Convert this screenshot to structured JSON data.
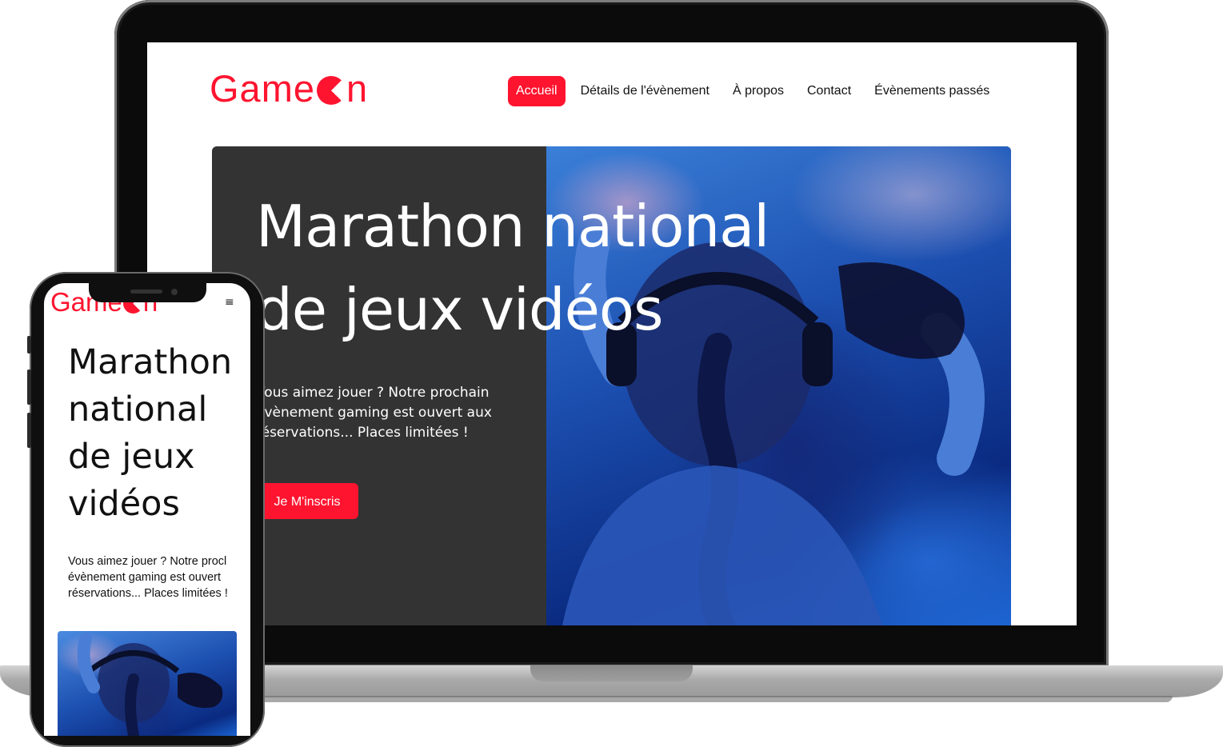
{
  "brand": {
    "logo_left": "Game",
    "logo_right": "n"
  },
  "nav": {
    "items": [
      {
        "label": "Accueil",
        "active": true
      },
      {
        "label": "Détails de l'évènement"
      },
      {
        "label": "À propos"
      },
      {
        "label": "Contact"
      },
      {
        "label": "Évènements passés"
      }
    ]
  },
  "hero": {
    "title": "Marathon national de jeux vidéos",
    "text": "Vous aimez jouer ? Notre prochain évènement gaming est ouvert aux réservations... Places limitées !",
    "cta_label": "Je M'inscris"
  },
  "mobile": {
    "menu_icon": "≡",
    "text_lines": [
      "Vous aimez jouer ? Notre procl",
      "évènement gaming est ouvert",
      "réservations... Places limitées !"
    ]
  },
  "colors": {
    "accent": "#fe142f",
    "hero_bg": "#333333"
  },
  "icons": [
    "pacman-o-icon",
    "hamburger-menu-icon"
  ]
}
